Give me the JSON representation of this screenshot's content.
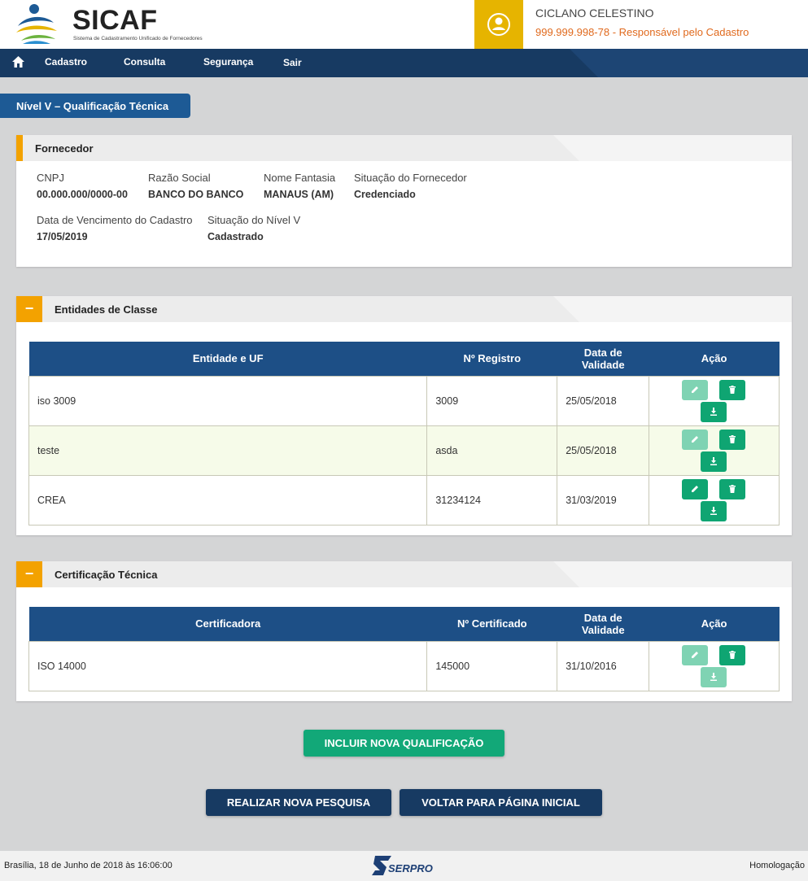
{
  "brand": {
    "title": "SICAF",
    "subtitle": "Sistema de Cadastramento Unificado de Fornecedores"
  },
  "user": {
    "name": "CICLANO CELESTINO",
    "document": "999.999.998-78",
    "role": " - Responsável pelo Cadastro"
  },
  "nav": {
    "items": [
      "Cadastro",
      "Consulta",
      "Segurança",
      "Sair"
    ]
  },
  "level_tab": "Nível V – Qualificação Técnica",
  "fornecedor": {
    "title": "Fornecedor",
    "cnpj_label": "CNPJ",
    "cnpj": "00.000.000/0000-00",
    "razao_label": "Razão Social",
    "razao": "BANCO DO BANCO",
    "fantasia_label": "Nome Fantasia",
    "fantasia": "MANAUS (AM)",
    "situacao_label": "Situação do Fornecedor",
    "situacao": "Credenciado",
    "vencimento_label": "Data de Vencimento do Cadastro",
    "vencimento": "17/05/2019",
    "nivel_label": "Situação do Nível V",
    "nivel": "Cadastrado"
  },
  "entidades": {
    "title": "Entidades de Classe",
    "toggle": "−",
    "columns": [
      "Entidade e UF",
      "Nº Registro",
      "Data de Validade",
      "Ação"
    ],
    "rows": [
      {
        "entidade": "iso 3009",
        "registro": "3009",
        "validade": "25/05/2018"
      },
      {
        "entidade": "teste",
        "registro": "asda",
        "validade": "25/05/2018"
      },
      {
        "entidade": "CREA",
        "registro": "31234124",
        "validade": "31/03/2019"
      }
    ]
  },
  "certificacao": {
    "title": "Certificação Técnica",
    "toggle": "−",
    "columns": [
      "Certificadora",
      "Nº Certificado",
      "Data de Validade",
      "Ação"
    ],
    "rows": [
      {
        "certificadora": "ISO 14000",
        "certificado": "145000",
        "validade": "31/10/2016"
      }
    ]
  },
  "buttons": {
    "incluir": "INCLUIR NOVA QUALIFICAÇÃO",
    "pesquisa": "REALIZAR NOVA PESQUISA",
    "voltar": "VOLTAR PARA PÁGINA INICIAL"
  },
  "footer": {
    "date": "Brasília, 18 de Junho de 2018 às 16:06:00",
    "logo_text": "SERPRO",
    "env": "Homologação"
  },
  "colors": {
    "nav": "#173a62",
    "accent": "#f3a200",
    "action": "#0fa572",
    "table_header": "#1d4f86"
  },
  "icons": [
    "user-icon",
    "home-icon",
    "edit-icon",
    "trash-icon",
    "download-icon"
  ]
}
